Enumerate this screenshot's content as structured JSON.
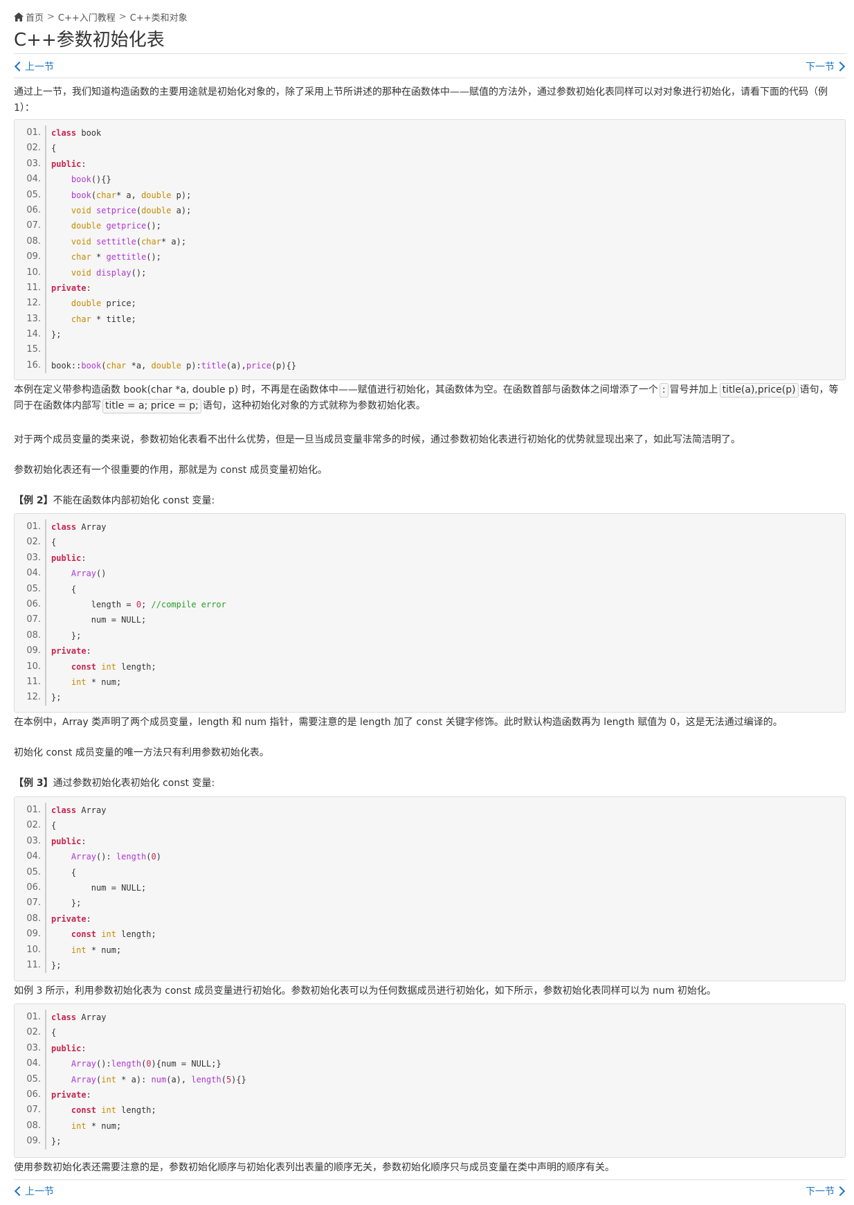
{
  "breadcrumb": {
    "home": "首页",
    "sep": ">",
    "level1": "C++入门教程",
    "level2": "C++类和对象"
  },
  "title": "C++参数初始化表",
  "nav": {
    "prev": "上一节",
    "next": "下一节"
  },
  "intro": "通过上一节，我们知道构造函数的主要用途就是初始化对象的，除了采用上节所讲述的那种在函数体中——赋值的方法外，通过参数初始化表同样可以对对象进行初始化，请看下面的代码（例1）：",
  "code1": [
    [
      [
        "kw",
        "class"
      ],
      [
        "t",
        " book"
      ]
    ],
    [
      [
        "t",
        "{"
      ]
    ],
    [
      [
        "kw",
        "public"
      ],
      [
        "t",
        ":"
      ]
    ],
    [
      [
        "t",
        "    "
      ],
      [
        "fn",
        "book"
      ],
      [
        "t",
        "(){}"
      ]
    ],
    [
      [
        "t",
        "    "
      ],
      [
        "fn",
        "book"
      ],
      [
        "t",
        "("
      ],
      [
        "ty",
        "char"
      ],
      [
        "t",
        "* a, "
      ],
      [
        "ty",
        "double"
      ],
      [
        "t",
        " p);"
      ]
    ],
    [
      [
        "t",
        "    "
      ],
      [
        "ty",
        "void"
      ],
      [
        "t",
        " "
      ],
      [
        "fn",
        "setprice"
      ],
      [
        "t",
        "("
      ],
      [
        "ty",
        "double"
      ],
      [
        "t",
        " a);"
      ]
    ],
    [
      [
        "t",
        "    "
      ],
      [
        "ty",
        "double"
      ],
      [
        "t",
        " "
      ],
      [
        "fn",
        "getprice"
      ],
      [
        "t",
        "();"
      ]
    ],
    [
      [
        "t",
        "    "
      ],
      [
        "ty",
        "void"
      ],
      [
        "t",
        " "
      ],
      [
        "fn",
        "settitle"
      ],
      [
        "t",
        "("
      ],
      [
        "ty",
        "char"
      ],
      [
        "t",
        "* a);"
      ]
    ],
    [
      [
        "t",
        "    "
      ],
      [
        "ty",
        "char"
      ],
      [
        "t",
        " * "
      ],
      [
        "fn",
        "gettitle"
      ],
      [
        "t",
        "();"
      ]
    ],
    [
      [
        "t",
        "    "
      ],
      [
        "ty",
        "void"
      ],
      [
        "t",
        " "
      ],
      [
        "fn",
        "display"
      ],
      [
        "t",
        "();"
      ]
    ],
    [
      [
        "kw",
        "private"
      ],
      [
        "t",
        ":"
      ]
    ],
    [
      [
        "t",
        "    "
      ],
      [
        "ty",
        "double"
      ],
      [
        "t",
        " price;"
      ]
    ],
    [
      [
        "t",
        "    "
      ],
      [
        "ty",
        "char"
      ],
      [
        "t",
        " * title;"
      ]
    ],
    [
      [
        "t",
        "};"
      ]
    ],
    [
      [
        "t",
        ""
      ]
    ],
    [
      [
        "t",
        "book::"
      ],
      [
        "fn",
        "book"
      ],
      [
        "t",
        "("
      ],
      [
        "ty",
        "char"
      ],
      [
        "t",
        " *a, "
      ],
      [
        "ty",
        "double"
      ],
      [
        "t",
        " p):"
      ],
      [
        "fn",
        "title"
      ],
      [
        "t",
        "(a),"
      ],
      [
        "fn",
        "price"
      ],
      [
        "t",
        "(p){}"
      ]
    ]
  ],
  "para1a": "本例在定义带参构造函数 book(char *a, double p) 时，不再是在函数体中——赋值进行初始化，其函数体为空。在函数首部与函数体之间增添了一个",
  "inline_colon": ":",
  "para1b": "冒号并加上",
  "inline_init": "title(a),price(p)",
  "para1c": "语句，等同于在函数体内部写",
  "inline_assign": "title = a; price = p;",
  "para1d": "语句，这种初始化对象的方式就称为参数初始化表。",
  "para2": "对于两个成员变量的类来说，参数初始化表看不出什么优势，但是一旦当成员变量非常多的时候，通过参数初始化表进行初始化的优势就显现出来了，如此写法简洁明了。",
  "para3": "参数初始化表还有一个很重要的作用，那就是为 const 成员变量初始化。",
  "ex2_label": "【例 2】",
  "ex2_text": "不能在函数体内部初始化 const 变量:",
  "code2": [
    [
      [
        "kw",
        "class"
      ],
      [
        "t",
        " Array"
      ]
    ],
    [
      [
        "t",
        "{"
      ]
    ],
    [
      [
        "kw",
        "public"
      ],
      [
        "t",
        ":"
      ]
    ],
    [
      [
        "t",
        "    "
      ],
      [
        "fn",
        "Array"
      ],
      [
        "t",
        "()"
      ]
    ],
    [
      [
        "t",
        "    {"
      ]
    ],
    [
      [
        "t",
        "        length = "
      ],
      [
        "nm",
        "0"
      ],
      [
        "t",
        "; "
      ],
      [
        "cm",
        "//compile error"
      ]
    ],
    [
      [
        "t",
        "        num = NULL;"
      ]
    ],
    [
      [
        "t",
        "    };"
      ]
    ],
    [
      [
        "kw",
        "private"
      ],
      [
        "t",
        ":"
      ]
    ],
    [
      [
        "t",
        "    "
      ],
      [
        "kw",
        "const"
      ],
      [
        "t",
        " "
      ],
      [
        "ty",
        "int"
      ],
      [
        "t",
        " length;"
      ]
    ],
    [
      [
        "t",
        "    "
      ],
      [
        "ty",
        "int"
      ],
      [
        "t",
        " * num;"
      ]
    ],
    [
      [
        "t",
        "};"
      ]
    ]
  ],
  "para4": "在本例中，Array 类声明了两个成员变量，length 和 num 指针，需要注意的是 length 加了 const 关键字修饰。此时默认构造函数再为 length 赋值为 0，这是无法通过编译的。",
  "para5": "初始化 const 成员变量的唯一方法只有利用参数初始化表。",
  "ex3_label": "【例 3】",
  "ex3_text": "通过参数初始化表初始化 const 变量:",
  "code3": [
    [
      [
        "kw",
        "class"
      ],
      [
        "t",
        " Array"
      ]
    ],
    [
      [
        "t",
        "{"
      ]
    ],
    [
      [
        "kw",
        "public"
      ],
      [
        "t",
        ":"
      ]
    ],
    [
      [
        "t",
        "    "
      ],
      [
        "fn",
        "Array"
      ],
      [
        "t",
        "(): "
      ],
      [
        "fn",
        "length"
      ],
      [
        "t",
        "("
      ],
      [
        "nm",
        "0"
      ],
      [
        "t",
        ")"
      ]
    ],
    [
      [
        "t",
        "    {"
      ]
    ],
    [
      [
        "t",
        "        num = NULL;"
      ]
    ],
    [
      [
        "t",
        "    };"
      ]
    ],
    [
      [
        "kw",
        "private"
      ],
      [
        "t",
        ":"
      ]
    ],
    [
      [
        "t",
        "    "
      ],
      [
        "kw",
        "const"
      ],
      [
        "t",
        " "
      ],
      [
        "ty",
        "int"
      ],
      [
        "t",
        " length;"
      ]
    ],
    [
      [
        "t",
        "    "
      ],
      [
        "ty",
        "int"
      ],
      [
        "t",
        " * num;"
      ]
    ],
    [
      [
        "t",
        "};"
      ]
    ]
  ],
  "para6": "如例 3 所示，利用参数初始化表为 const 成员变量进行初始化。参数初始化表可以为任何数据成员进行初始化，如下所示，参数初始化表同样可以为 num 初始化。",
  "code4": [
    [
      [
        "kw",
        "class"
      ],
      [
        "t",
        " Array"
      ]
    ],
    [
      [
        "t",
        "{"
      ]
    ],
    [
      [
        "kw",
        "public"
      ],
      [
        "t",
        ":"
      ]
    ],
    [
      [
        "t",
        "    "
      ],
      [
        "fn",
        "Array"
      ],
      [
        "t",
        "():"
      ],
      [
        "fn",
        "length"
      ],
      [
        "t",
        "("
      ],
      [
        "nm",
        "0"
      ],
      [
        "t",
        "){num = NULL;}"
      ]
    ],
    [
      [
        "t",
        "    "
      ],
      [
        "fn",
        "Array"
      ],
      [
        "t",
        "("
      ],
      [
        "ty",
        "int"
      ],
      [
        "t",
        " * a): "
      ],
      [
        "fn",
        "num"
      ],
      [
        "t",
        "(a), "
      ],
      [
        "fn",
        "length"
      ],
      [
        "t",
        "("
      ],
      [
        "nm",
        "5"
      ],
      [
        "t",
        "){}"
      ]
    ],
    [
      [
        "kw",
        "private"
      ],
      [
        "t",
        ":"
      ]
    ],
    [
      [
        "t",
        "    "
      ],
      [
        "kw",
        "const"
      ],
      [
        "t",
        " "
      ],
      [
        "ty",
        "int"
      ],
      [
        "t",
        " length;"
      ]
    ],
    [
      [
        "t",
        "    "
      ],
      [
        "ty",
        "int"
      ],
      [
        "t",
        " * num;"
      ]
    ],
    [
      [
        "t",
        "};"
      ]
    ]
  ],
  "para7": "使用参数初始化表还需要注意的是，参数初始化顺序与初始化表列出表量的顺序无关，参数初始化顺序只与成员变量在类中声明的顺序有关。"
}
